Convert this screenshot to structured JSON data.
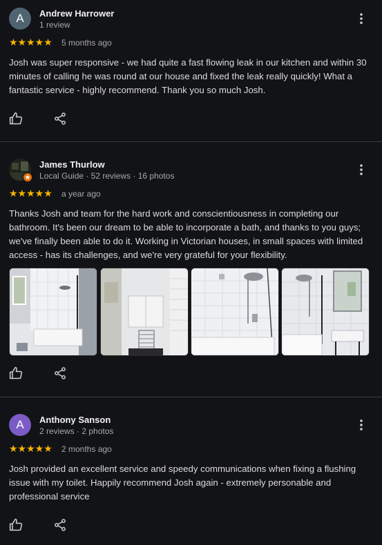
{
  "reviews": [
    {
      "author": "Andrew Harrower",
      "avatar_letter": "A",
      "meta": "1 review",
      "stars": "★★★★★",
      "date": "5 months ago",
      "text": "Josh was super responsive - we had quite a fast flowing leak in our kitchen and within 30 minutes of calling he was round at our house and fixed the leak really quickly! What a fantastic service - highly recommend. Thank you so much Josh.",
      "avatar_color": "#4f6370"
    },
    {
      "author": "James Thurlow",
      "meta": "Local Guide · 52 reviews · 16 photos",
      "stars": "★★★★★",
      "date": "a year ago",
      "text": "Thanks Josh and team for the hard work and conscientiousness in completing our bathroom. It's been our dream to be able to incorporate a bath, and thanks to you guys; we've finally been able to do it. Working in Victorian houses, in small spaces with limited access - has its challenges, and we're very grateful for your flexibility.",
      "photos": [
        "bathroom-photo-1",
        "bathroom-photo-2",
        "bathroom-photo-3",
        "bathroom-photo-4"
      ]
    },
    {
      "author": "Anthony Sanson",
      "avatar_letter": "A",
      "meta": "2 reviews · 2 photos",
      "stars": "★★★★★",
      "date": "2 months ago",
      "text": "Josh provided an excellent service and speedy communications when fixing a flushing issue with my toilet. Happily recommend Josh again - extremely personable and professional service",
      "avatar_color": "#7b5cc7"
    }
  ],
  "icons": {
    "like": "thumbs-up-icon",
    "share": "share-icon",
    "more": "more-vert-icon",
    "badge": "local-guide-badge-icon"
  },
  "colors": {
    "background": "#121316",
    "stars": "#f6b400",
    "divider": "#3a3b3e"
  }
}
